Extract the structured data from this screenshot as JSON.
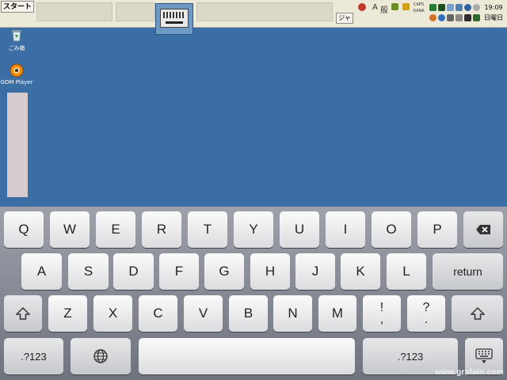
{
  "taskbar": {
    "start_label": "スタート",
    "lang_button": "ジャ",
    "ime": {
      "mode": "A",
      "kana": "般",
      "caps": "CAPS",
      "kana2": "KANA"
    },
    "clock": {
      "time": "19:09",
      "day": "日曜日"
    }
  },
  "desktop": {
    "icons": [
      {
        "label": "ごみ箱",
        "icon": "recycle-bin-icon"
      },
      {
        "label": "GOM Player",
        "icon": "gom-player-icon"
      }
    ]
  },
  "keyboard": {
    "row1": [
      "Q",
      "W",
      "E",
      "R",
      "T",
      "Y",
      "U",
      "I",
      "O",
      "P"
    ],
    "row2": [
      "A",
      "S",
      "D",
      "F",
      "G",
      "H",
      "J",
      "K",
      "L"
    ],
    "row2_return": "return",
    "row3": [
      "Z",
      "X",
      "C",
      "V",
      "B",
      "N",
      "M"
    ],
    "row3_punct": [
      [
        "!",
        ","
      ],
      [
        "?",
        "."
      ]
    ],
    "row4_numbers_label": ".?123",
    "icons": {
      "backspace": "backspace-icon",
      "shift": "shift-icon",
      "globe": "globe-icon",
      "hide": "keyboard-hide-icon"
    },
    "colors": {
      "key": "#f4f4f6",
      "keyboard_bg": "#858893"
    }
  },
  "watermark": "www.grafain.com"
}
